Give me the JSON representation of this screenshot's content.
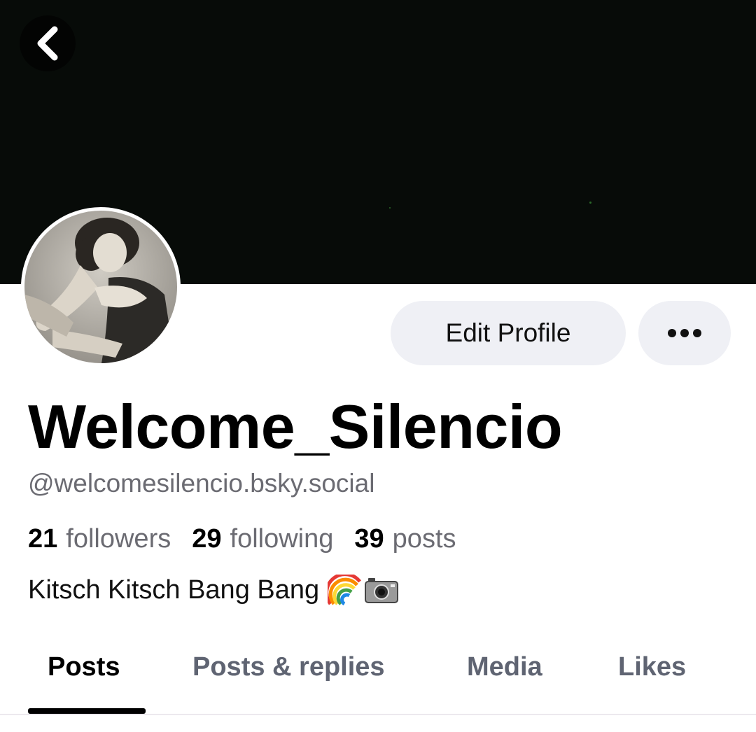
{
  "banner": {
    "color": "#070b08"
  },
  "back": {
    "icon": "chevron-left-icon"
  },
  "avatar": {
    "description_icon": "avatar-icon"
  },
  "actions": {
    "edit_profile_label": "Edit Profile",
    "more_icon": "ellipsis-icon"
  },
  "profile": {
    "display_name": "Welcome_Silencio",
    "handle": "@welcomesilencio.bsky.social",
    "stats": {
      "followers_count": "21",
      "followers_label": "followers",
      "following_count": "29",
      "following_label": "following",
      "posts_count": "39",
      "posts_label": "posts"
    },
    "bio_text": "Kitsch Kitsch Bang Bang",
    "bio_emojis": [
      "rainbow-icon",
      "camera-icon"
    ]
  },
  "tabs": [
    {
      "label": "Posts",
      "active": true
    },
    {
      "label": "Posts & replies",
      "active": false
    },
    {
      "label": "Media",
      "active": false
    },
    {
      "label": "Likes",
      "active": false
    }
  ],
  "colors": {
    "accent_button_bg": "#eff0f5",
    "muted_text": "#6b6b72",
    "tab_inactive": "#5f6472"
  }
}
